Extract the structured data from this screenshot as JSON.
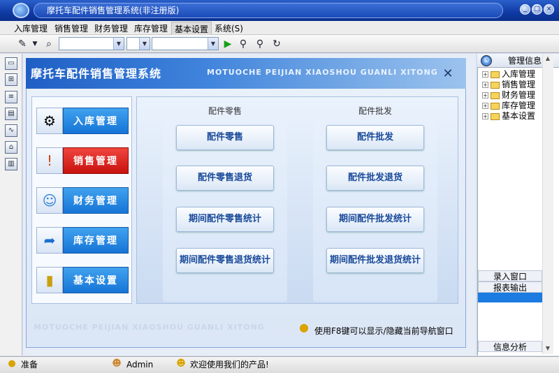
{
  "window": {
    "title": "摩托车配件销售管理系统(非注册版)"
  },
  "menu": [
    "入库管理",
    "销售管理",
    "财务管理",
    "库存管理",
    "基本设置",
    "系统(S)"
  ],
  "banner": {
    "title": "摩托车配件销售管理系统",
    "subtitle": "MOTUOCHE PEIJIAN XIAOSHOU GUANLI XITONG"
  },
  "nav": [
    {
      "label": "入库管理",
      "icon": "gear-icon",
      "active": false
    },
    {
      "label": "销售管理",
      "icon": "alert-monitor-icon",
      "active": true
    },
    {
      "label": "财务管理",
      "icon": "people-icon",
      "active": false
    },
    {
      "label": "库存管理",
      "icon": "arrow-icon",
      "active": false
    },
    {
      "label": "基本设置",
      "icon": "chart-icon",
      "active": false
    }
  ],
  "retail": {
    "header": "配件零售",
    "buttons": [
      "配件零售",
      "配件零售退货",
      "期间配件零售统计",
      "期间配件零售退货统计"
    ]
  },
  "wholesale": {
    "header": "配件批发",
    "buttons": [
      "配件批发",
      "配件批发退货",
      "期间配件批发统计",
      "期间配件批发退货统计"
    ]
  },
  "footer": {
    "watermark": "MOTUOCHE PEIJIAN XIAOSHOU GUANLI XITONG",
    "hint": "使用F8键可以显示/隐藏当前导航窗口"
  },
  "right_panel": {
    "header": "管理信息",
    "tree": [
      "入库管理",
      "销售管理",
      "财务管理",
      "库存管理",
      "基本设置"
    ],
    "tabs": [
      "录入窗口",
      "报表输出"
    ],
    "bottom_tab": "信息分析"
  },
  "status": {
    "state": "准备",
    "user": "Admin",
    "message": "欢迎使用我们的产品!"
  }
}
